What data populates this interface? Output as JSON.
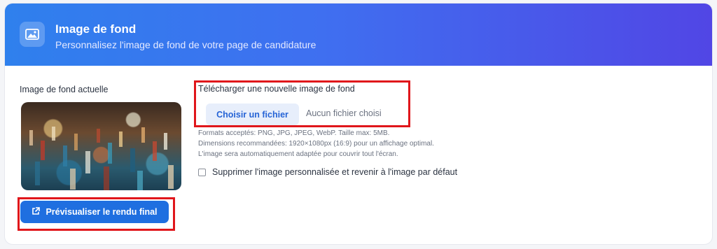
{
  "header": {
    "title": "Image de fond",
    "subtitle": "Personnalisez l'image de fond de votre page de candidature",
    "icon": "image-icon"
  },
  "current": {
    "label": "Image de fond actuelle",
    "preview_button_label": "Prévisualiser le rendu final",
    "preview_icon": "external-link-icon"
  },
  "upload": {
    "label": "Télécharger une nouvelle image de fond",
    "choose_button_label": "Choisir un fichier",
    "no_file_text": "Aucun fichier choisi",
    "hints": [
      "Formats acceptés: PNG, JPG, JPEG, WebP. Taille max: 5MB.",
      "Dimensions recommandées: 1920×1080px (16:9) pour un affichage optimal.",
      "L'image sera automatiquement adaptée pour couvrir tout l'écran."
    ]
  },
  "reset": {
    "label": "Supprimer l'image personnalisée et revenir à l'image par défaut",
    "checked": false
  },
  "colors": {
    "header_start": "#2f80ed",
    "header_end": "#5146e5",
    "primary_button": "#1f6fe0",
    "highlight": "#e0161b"
  }
}
